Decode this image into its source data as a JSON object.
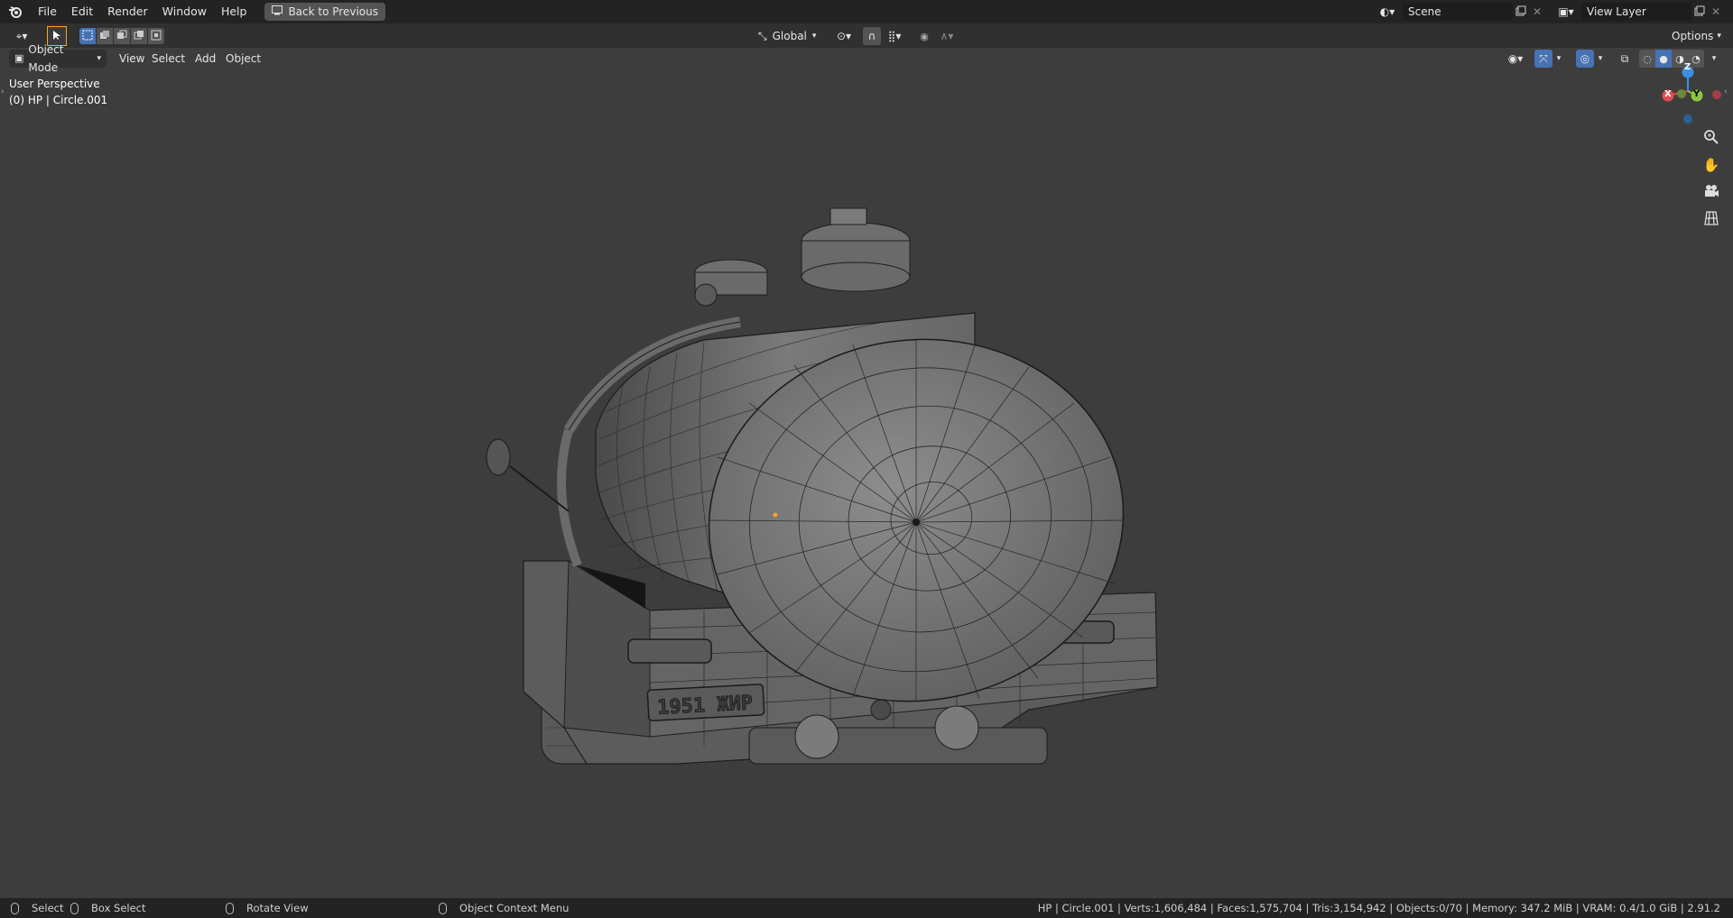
{
  "topbar": {
    "menus": [
      "File",
      "Edit",
      "Render",
      "Window",
      "Help"
    ],
    "back_button": "Back to Previous",
    "scene_value": "Scene",
    "view_layer_value": "View Layer"
  },
  "toolheader": {
    "orientation": "Global",
    "options_label": "Options"
  },
  "viewheader": {
    "mode": "Object Mode",
    "menus": [
      "View",
      "Select",
      "Add",
      "Object"
    ]
  },
  "viewport": {
    "perspective_label": "User Perspective",
    "object_label": "(0) HP | Circle.001",
    "license_plate": "1951 ЖИР",
    "gizmo": {
      "x": "X",
      "y": "Y",
      "z": "Z"
    }
  },
  "statusbar": {
    "select": "Select",
    "box_select": "Box Select",
    "rotate_view": "Rotate View",
    "context_menu": "Object Context Menu",
    "stats": "HP | Circle.001 | Verts:1,606,484 | Faces:1,575,704 | Tris:3,154,942 | Objects:0/70 | Memory: 347.2 MiB | VRAM: 0.4/1.0 GiB | 2.91.2"
  },
  "icons": [
    "blender-logo-icon",
    "back-icon",
    "scene-icon",
    "copy-icon",
    "close-icon",
    "view-layer-icon",
    "editor-type-icon",
    "cursor-tool-icon",
    "select-box-icon",
    "transform-orientation-icon",
    "pivot-icon",
    "snap-icon",
    "proportional-icon",
    "visibility-icon",
    "gizmo-icon",
    "overlay-icon",
    "xray-icon",
    "shading-wireframe-icon",
    "shading-solid-icon",
    "shading-material-icon",
    "shading-rendered-icon",
    "zoom-icon",
    "hand-icon",
    "camera-icon",
    "grid-icon"
  ],
  "colors": {
    "accent_blue": "#4772b3",
    "axis_x": "#e24b52",
    "axis_y": "#8cc63f",
    "axis_z": "#3b8fe5",
    "selection_orange": "#f5a623"
  }
}
